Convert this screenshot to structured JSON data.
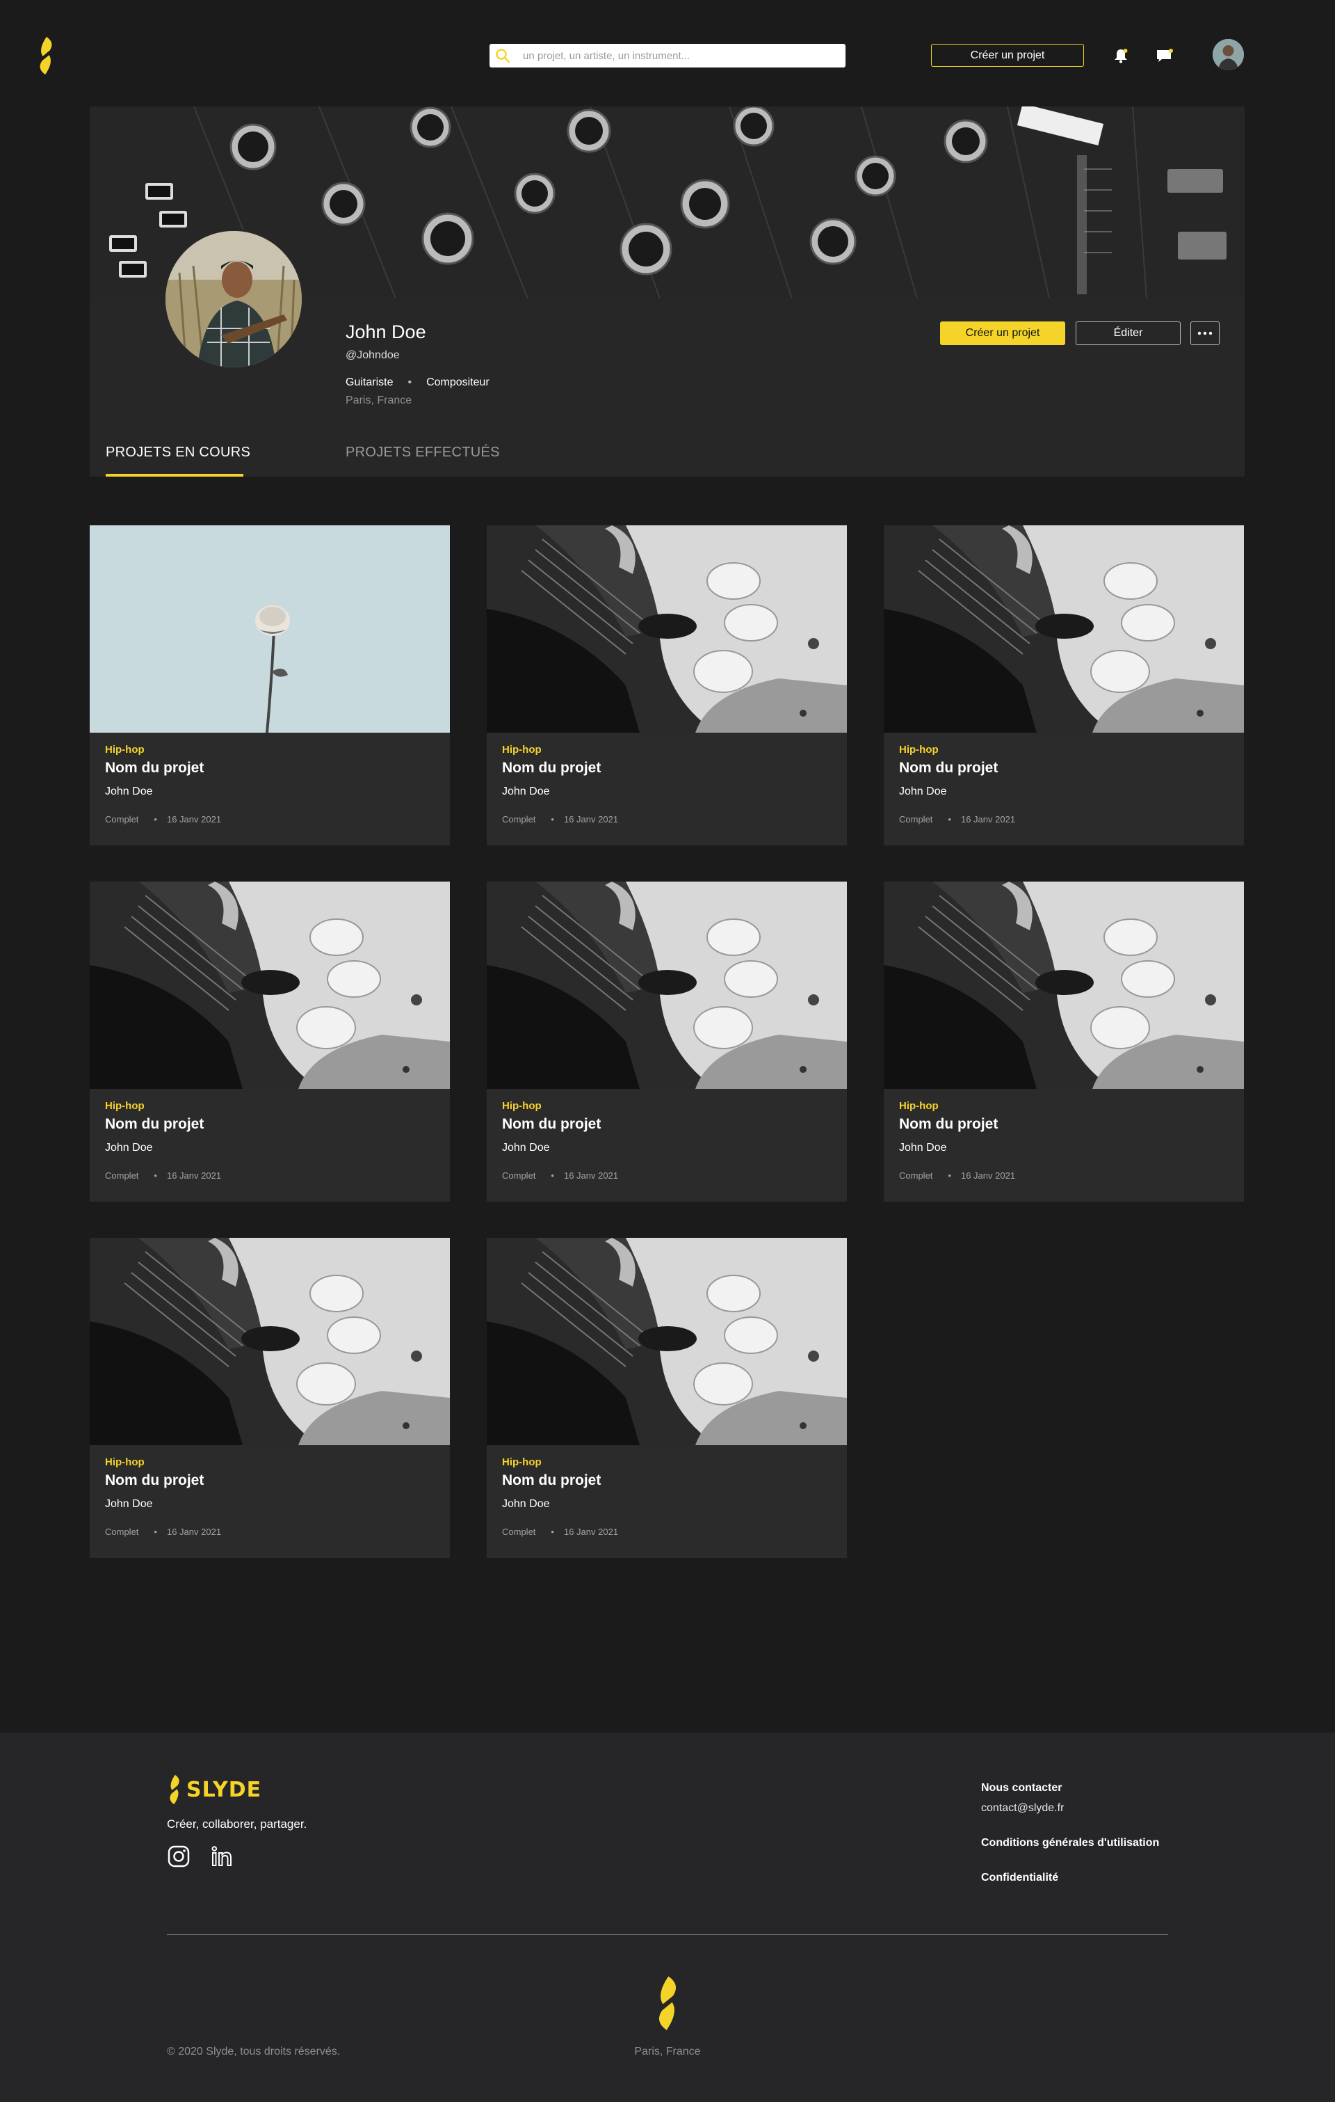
{
  "colors": {
    "accent": "#f5d42a",
    "background": "#1c1b1c",
    "panel": "#282728",
    "card": "#2c2b2c"
  },
  "header": {
    "logo_icon": "slyde-s-logo",
    "search_placeholder": "un projet, un artiste, un instrument...",
    "create_label": "Créer un projet",
    "icons": [
      "search-icon",
      "bell-icon",
      "chat-icon",
      "user-avatar"
    ]
  },
  "profile": {
    "name": "John Doe",
    "handle": "@Johndoe",
    "roles": [
      "Guitariste",
      "Compositeur"
    ],
    "location": "Paris, France",
    "create_label": "Créer un projet",
    "edit_label": "Éditer",
    "more_label": "···"
  },
  "tabs": [
    {
      "label": "PROJETS EN COURS",
      "active": true
    },
    {
      "label": "PROJETS EFFECTUÉS",
      "active": false
    }
  ],
  "projects": [
    {
      "genre": "Hip-hop",
      "name": "Nom du projet",
      "author": "John Doe",
      "status": "Complet",
      "date": "16 Janv 2021",
      "image": "rose-photo"
    },
    {
      "genre": "Hip-hop",
      "name": "Nom du projet",
      "author": "John Doe",
      "status": "Complet",
      "date": "16 Janv 2021",
      "image": "guitar-photo"
    },
    {
      "genre": "Hip-hop",
      "name": "Nom du projet",
      "author": "John Doe",
      "status": "Complet",
      "date": "16 Janv 2021",
      "image": "guitar-photo"
    },
    {
      "genre": "Hip-hop",
      "name": "Nom du projet",
      "author": "John Doe",
      "status": "Complet",
      "date": "16 Janv 2021",
      "image": "guitar-photo"
    },
    {
      "genre": "Hip-hop",
      "name": "Nom du projet",
      "author": "John Doe",
      "status": "Complet",
      "date": "16 Janv 2021",
      "image": "guitar-photo"
    },
    {
      "genre": "Hip-hop",
      "name": "Nom du projet",
      "author": "John Doe",
      "status": "Complet",
      "date": "16 Janv 2021",
      "image": "guitar-photo"
    },
    {
      "genre": "Hip-hop",
      "name": "Nom du projet",
      "author": "John Doe",
      "status": "Complet",
      "date": "16 Janv 2021",
      "image": "guitar-photo"
    },
    {
      "genre": "Hip-hop",
      "name": "Nom du projet",
      "author": "John Doe",
      "status": "Complet",
      "date": "16 Janv 2021",
      "image": "guitar-photo"
    }
  ],
  "footer": {
    "brand": "SLYDE",
    "tagline": "Créer, collaborer, partager.",
    "social": [
      "instagram-icon",
      "linkedin-icon"
    ],
    "contact_heading": "Nous contacter",
    "contact_email": "contact@slyde.fr",
    "terms": "Conditions générales d'utilisation",
    "privacy": "Confidentialité",
    "copyright": "© 2020 Slyde, tous droits réservés.",
    "city": "Paris, France"
  }
}
